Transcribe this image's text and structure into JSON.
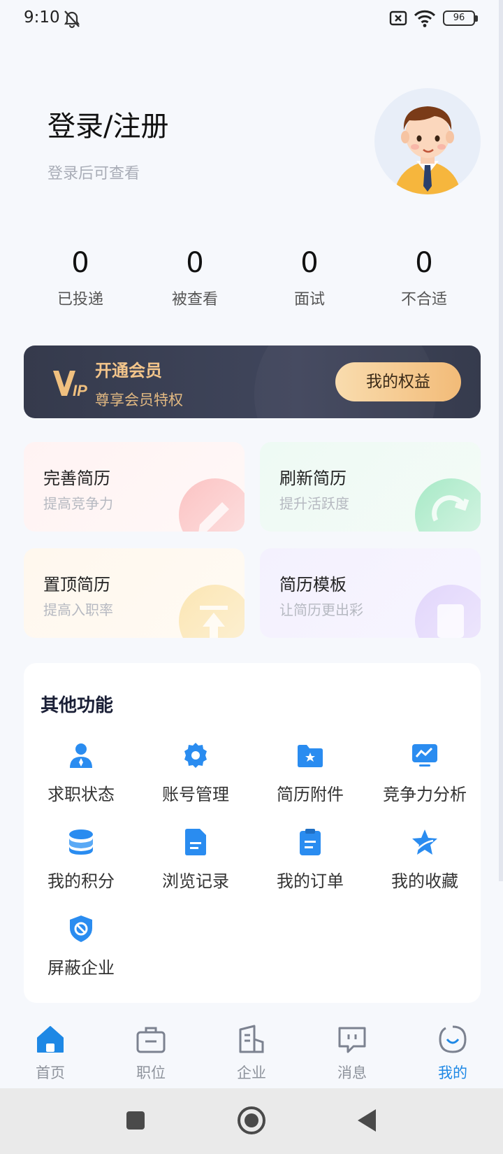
{
  "status_bar": {
    "time": "9:10",
    "battery": "96",
    "icons": [
      "mute-alarm-icon",
      "no-sim-icon",
      "wifi-icon",
      "battery-icon"
    ]
  },
  "profile": {
    "title": "登录/注册",
    "subtitle": "登录后可查看",
    "avatar_icon": "user-avatar"
  },
  "stats": [
    {
      "value": "0",
      "label": "已投递"
    },
    {
      "value": "0",
      "label": "被查看"
    },
    {
      "value": "0",
      "label": "面试"
    },
    {
      "value": "0",
      "label": "不合适"
    }
  ],
  "vip": {
    "logo_icon": "vip-logo",
    "title": "开通会员",
    "subtitle": "尊享会员特权",
    "button": "我的权益"
  },
  "cards": [
    {
      "title": "完善简历",
      "subtitle": "提高竞争力",
      "icon": "pencil-icon",
      "accent": "#f9b5b5"
    },
    {
      "title": "刷新简历",
      "subtitle": "提升活跃度",
      "icon": "refresh-icon",
      "accent": "#9fe3bd"
    },
    {
      "title": "置顶简历",
      "subtitle": "提高入职率",
      "icon": "pin-top-icon",
      "accent": "#fbe3a8"
    },
    {
      "title": "简历模板",
      "subtitle": "让简历更出彩",
      "icon": "template-icon",
      "accent": "#ddd0fa"
    }
  ],
  "other": {
    "title": "其他功能",
    "items": [
      {
        "label": "求职状态",
        "icon": "person-icon"
      },
      {
        "label": "账号管理",
        "icon": "gear-icon"
      },
      {
        "label": "简历附件",
        "icon": "folder-star-icon"
      },
      {
        "label": "竞争力分析",
        "icon": "chart-monitor-icon"
      },
      {
        "label": "我的积分",
        "icon": "coins-icon"
      },
      {
        "label": "浏览记录",
        "icon": "document-icon"
      },
      {
        "label": "我的订单",
        "icon": "clipboard-icon"
      },
      {
        "label": "我的收藏",
        "icon": "star-icon"
      },
      {
        "label": "屏蔽企业",
        "icon": "shield-block-icon"
      }
    ]
  },
  "nav": [
    {
      "label": "首页",
      "icon": "home-icon",
      "active": false
    },
    {
      "label": "职位",
      "icon": "briefcase-icon",
      "active": false
    },
    {
      "label": "企业",
      "icon": "building-icon",
      "active": false
    },
    {
      "label": "消息",
      "icon": "message-icon",
      "active": false
    },
    {
      "label": "我的",
      "icon": "profile-face-icon",
      "active": true
    }
  ],
  "colors": {
    "primary": "#1e88e5",
    "vip_gold": "#f3c58b",
    "vip_bg": "#3b4053"
  }
}
